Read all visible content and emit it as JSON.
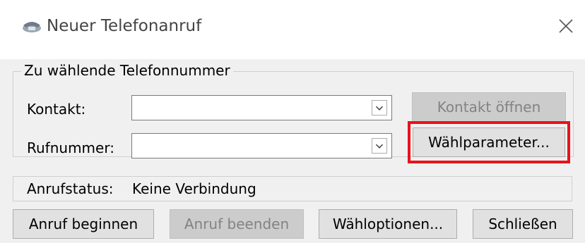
{
  "window": {
    "title": "Neuer Telefonanruf"
  },
  "group": {
    "legend": "Zu wählende Telefonnummer",
    "contact_label": "Kontakt:",
    "contact_value": "",
    "number_label": "Rufnummer:",
    "number_value": "",
    "open_contact_button": "Kontakt öffnen",
    "dial_params_button": "Wählparameter..."
  },
  "status": {
    "label": "Anrufstatus:",
    "value": "Keine Verbindung"
  },
  "footer": {
    "start_call": "Anruf beginnen",
    "end_call": "Anruf beenden",
    "dial_options": "Wähloptionen...",
    "close": "Schließen"
  },
  "colors": {
    "highlight": "#e8121b",
    "window_bg": "#f0f0f0"
  },
  "icons": {
    "title": "phone-icon",
    "close": "close-icon",
    "dropdown": "chevron-down-icon"
  }
}
